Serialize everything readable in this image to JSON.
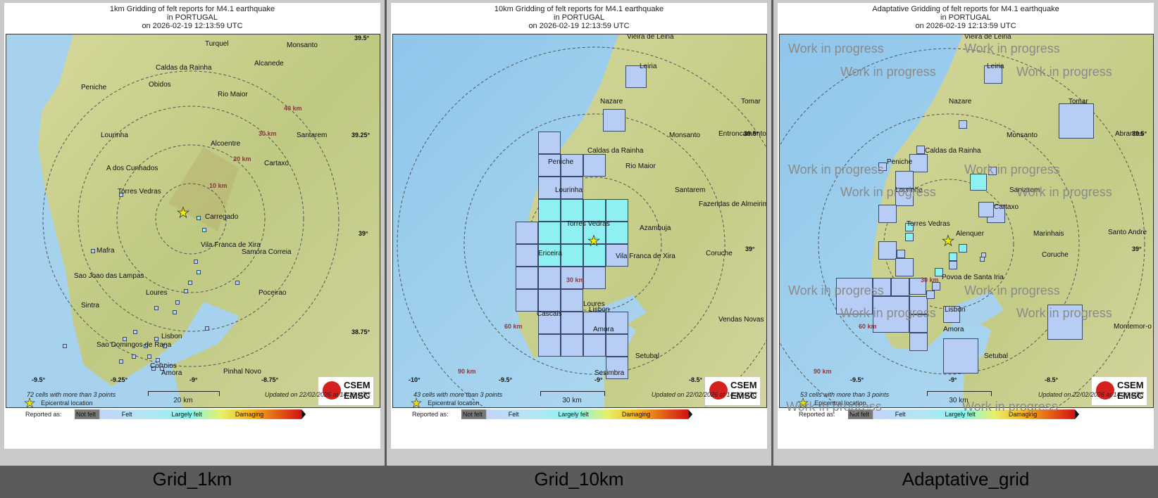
{
  "panels": [
    {
      "title": [
        "1km Gridding of felt reports for M4.1 earthquake",
        "in PORTUGAL",
        "on  2026-02-19 12:13:59 UTC"
      ],
      "caption": "Grid_1km",
      "cells_text": "72 cells with more than 3 points",
      "updated_text": "Updated on 22/02/2026 at 14:19 UTC",
      "scale_label": "20 km",
      "cities": [
        "Turquel",
        "Monsanto",
        "Caldas da Rainha",
        "Alcanede",
        "Peniche",
        "Obidos",
        "Rio Maior",
        "Lourinha",
        "Alcoentre",
        "Santarem",
        "A dos Cunhados",
        "Cartaxo",
        "Torres Vedras",
        "Carregado",
        "Vila Franca de Xira",
        "Samora Correia",
        "Mafra",
        "Sao Joao das Lampas",
        "Loures",
        "Poceirao",
        "Sintra",
        "Lisbon",
        "Sao Domingos de Rana",
        "Corroios",
        "Amora",
        "Pinhal Novo"
      ],
      "distances": [
        "10 km",
        "20 km",
        "30 km",
        "40 km"
      ],
      "coords": [
        "39.5°",
        "39.25°",
        "39°",
        "38.75°",
        "-9.5°",
        "-9.25°",
        "-9°",
        "-8.75°"
      ]
    },
    {
      "title": [
        "10km Gridding of felt reports for M4.1 earthquake",
        "in PORTUGAL",
        "on  2026-02-19 12:13:59 UTC"
      ],
      "caption": "Grid_10km",
      "cells_text": "43 cells with more than 3 points",
      "updated_text": "Updated on 22/02/2026 at 14:20 UTC",
      "scale_label": "30 km",
      "cities": [
        "Vieira de Leiria",
        "Leiria",
        "Nazare",
        "Tomar",
        "Monsanto",
        "Entroncamento",
        "Caldas da Rainha",
        "Peniche",
        "Rio Maior",
        "Lourinha",
        "Santarem",
        "Fazendas de Almeirim",
        "Torres Vedras",
        "Azambuja",
        "Ericeira",
        "Vila Franca de Xira",
        "Coruche",
        "Loures",
        "Cascais",
        "Lisbon",
        "Amora",
        "Vendas Novas",
        "Setubal",
        "Sesimbra"
      ],
      "distances": [
        "30 km",
        "60 km",
        "90 km"
      ],
      "coords": [
        "39.5°",
        "39°",
        "-10°",
        "-9.5°",
        "-9°",
        "-8.5°"
      ]
    },
    {
      "title": [
        "Adaptative Gridding of felt reports for M4.1 earthquake",
        "in PORTUGAL",
        "on  2026-02-19 12:13:59 UTC"
      ],
      "caption": "Adaptative_grid",
      "cells_text": "53 cells with more than 3 points",
      "updated_text": "Updated on 22/02/2026 at 14:20 UTC",
      "scale_label": "30 km",
      "cities": [
        "Vieira de Leiria",
        "Leiria",
        "Nazare",
        "Tomar",
        "Monsanto",
        "Abrantes",
        "Caldas da Rainha",
        "Peniche",
        "Lourinha",
        "Santarem",
        "Cartaxo",
        "Torres Vedras",
        "Alenquer",
        "Marinhais",
        "Santo Andre",
        "Coruche",
        "Povoa de Santa Iria",
        "Lisbon",
        "Amora",
        "Montemor-o",
        "Setubal"
      ],
      "distances": [
        "30 km",
        "60 km",
        "90 km"
      ],
      "coords": [
        "39.5°",
        "39°",
        "-9.5°",
        "-9°",
        "-8.5°"
      ],
      "watermark": "Work in progress"
    }
  ],
  "legend": {
    "epicentral": "Epicentral location",
    "reported_as": "Reported as:",
    "classes": [
      "Not felt",
      "Felt",
      "Largely felt",
      "Damaging"
    ]
  },
  "logo": {
    "line1": "CSEM",
    "line2": "EMSC"
  },
  "colors": {
    "sea": "#a7d2ee",
    "land": "#c9cf8a",
    "felt_cell": "#b8cdf6",
    "felt_cell_strong": "#8ef0f0",
    "star": "#f2ee00"
  }
}
